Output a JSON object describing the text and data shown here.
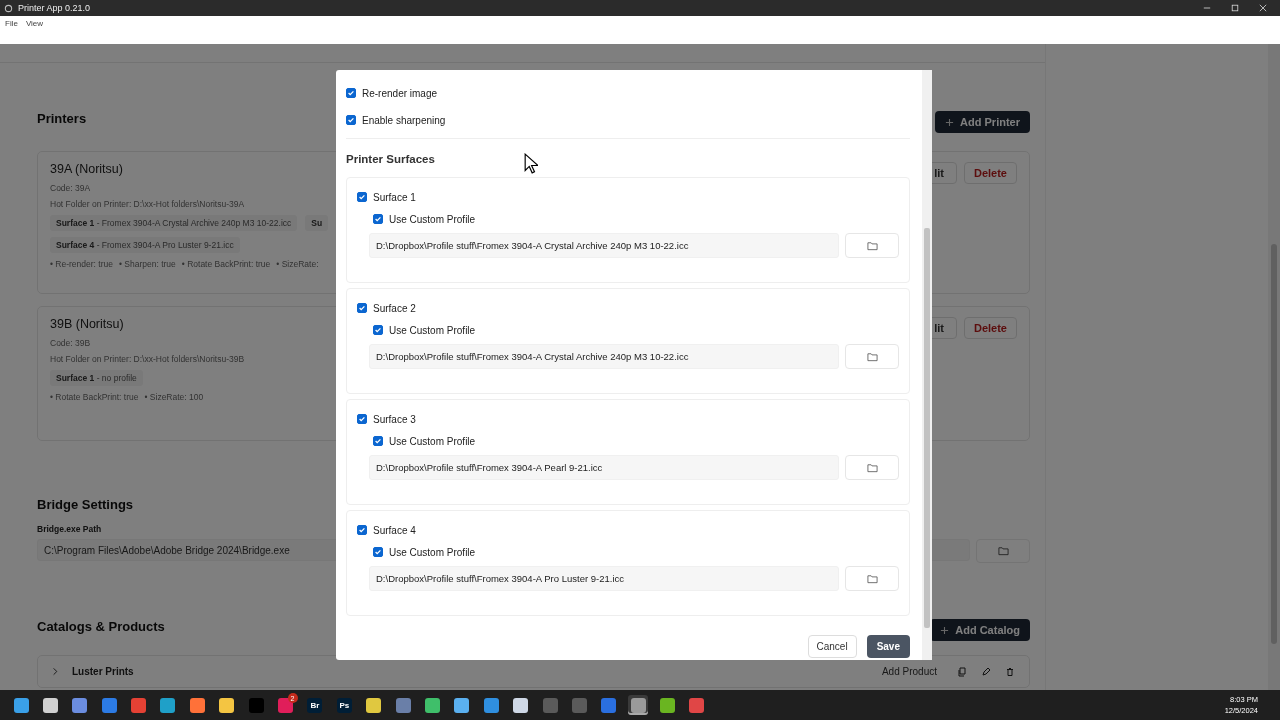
{
  "window": {
    "title": "Printer App 0.21.0"
  },
  "menu": [
    {
      "label": "File"
    },
    {
      "label": "View"
    }
  ],
  "printers": {
    "heading": "Printers",
    "add_button": "Add Printer",
    "items": [
      {
        "name": "39A (Noritsu)",
        "code": "Code: 39A",
        "hot_folder": "Hot Folder on Printer: D:\\xx-Hot folders\\Noritsu-39A",
        "chip_rows": [
          [
            {
              "text": "**Surface 1** - Fromex 3904-A Crystal Archive 240p M3 10-22.icc"
            },
            {
              "text": "**Su**"
            }
          ],
          [
            {
              "text": "**Surface 4** - Fromex 3904-A Pro Luster 9-21.icc"
            }
          ]
        ],
        "flags": [
          "• Re-render: true",
          "• Sharpen: true",
          "• Rotate BackPrint: true",
          "• SizeRate:"
        ],
        "edit": "lit",
        "delete": "Delete"
      },
      {
        "name": "39B (Noritsu)",
        "code": "Code: 39B",
        "hot_folder": "Hot Folder on Printer: D:\\xx-Hot folders\\Noritsu-39B",
        "chip_rows": [
          [
            {
              "text": "**Surface 1** - no profile"
            }
          ]
        ],
        "flags": [
          "• Rotate BackPrint: true",
          "• SizeRate: 100"
        ],
        "edit": "lit",
        "delete": "Delete"
      }
    ]
  },
  "bridge": {
    "heading": "Bridge Settings",
    "label": "Bridge.exe Path",
    "value": "C:\\Program Files\\Adobe\\Adobe Bridge 2024\\Bridge.exe"
  },
  "catalogs": {
    "heading": "Catalogs & Products",
    "add_button": "Add Catalog",
    "items": [
      {
        "name": "Luster Prints",
        "add_product": "Add Product"
      }
    ]
  },
  "modal": {
    "options": [
      {
        "label": "Re-render image",
        "checked": true
      },
      {
        "label": "Enable sharpening",
        "checked": true
      }
    ],
    "surfaces_heading": "Printer Surfaces",
    "surfaces": [
      {
        "name": "Surface 1",
        "checked": true,
        "custom_label": "Use Custom Profile",
        "custom_checked": true,
        "path": "D:\\Dropbox\\Profile stuff\\Fromex 3904-A Crystal Archive 240p M3 10-22.icc"
      },
      {
        "name": "Surface 2",
        "checked": true,
        "custom_label": "Use Custom Profile",
        "custom_checked": true,
        "path": "D:\\Dropbox\\Profile stuff\\Fromex 3904-A Crystal Archive 240p M3 10-22.icc"
      },
      {
        "name": "Surface 3",
        "checked": true,
        "custom_label": "Use Custom Profile",
        "custom_checked": true,
        "path": "D:\\Dropbox\\Profile stuff\\Fromex 3904-A Pearl 9-21.icc"
      },
      {
        "name": "Surface 4",
        "checked": true,
        "custom_label": "Use Custom Profile",
        "custom_checked": true,
        "path": "D:\\Dropbox\\Profile stuff\\Fromex 3904-A Pro Luster 9-21.icc"
      }
    ],
    "cancel": "Cancel",
    "save": "Save"
  },
  "taskbar": {
    "apps": [
      {
        "color": "#3aa0e8",
        "selected": false
      },
      {
        "color": "#d0d0d0",
        "selected": false
      },
      {
        "color": "#6b8de0",
        "selected": false
      },
      {
        "color": "#2c7be5",
        "selected": false
      },
      {
        "color": "#e44134",
        "selected": false
      },
      {
        "color": "#1fa0c8",
        "selected": false
      },
      {
        "color": "#ff7139",
        "selected": false
      },
      {
        "color": "#f4c542",
        "selected": false
      },
      {
        "color": "#000000",
        "selected": false
      },
      {
        "color": "#e01e5a",
        "selected": false,
        "badge": "2"
      },
      {
        "color": "#001e36",
        "selected": false,
        "label": "Br"
      },
      {
        "color": "#001e36",
        "selected": false,
        "label": "Ps"
      },
      {
        "color": "#e0c840",
        "selected": false
      },
      {
        "color": "#6a7fa8",
        "selected": false
      },
      {
        "color": "#3fbf6a",
        "selected": false
      },
      {
        "color": "#5ab0f0",
        "selected": false
      },
      {
        "color": "#2f8fe0",
        "selected": false
      },
      {
        "color": "#cfd8e6",
        "selected": false
      },
      {
        "color": "#5a5a5a",
        "selected": false
      },
      {
        "color": "#5a5a5a",
        "selected": false
      },
      {
        "color": "#2a6fe0",
        "selected": false
      },
      {
        "color": "#9a9a9a",
        "selected": true
      },
      {
        "color": "#6ab521",
        "selected": false
      },
      {
        "color": "#e04646",
        "selected": false
      }
    ],
    "time": "8:03 PM",
    "date": "12/5/2024"
  }
}
